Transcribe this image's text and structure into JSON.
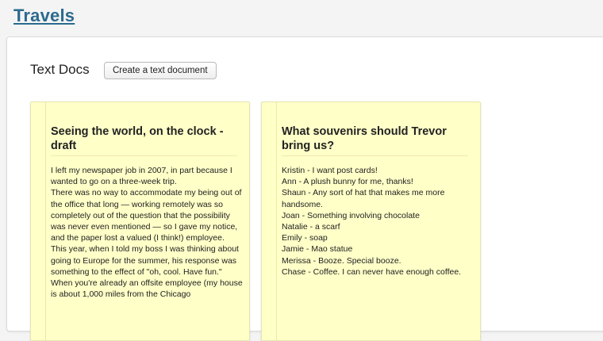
{
  "header": {
    "title": "Travels"
  },
  "section": {
    "title": "Text Docs",
    "create_label": "Create a text document"
  },
  "documents": [
    {
      "title": "Seeing the world, on the clock - draft",
      "lines": [
        "I left my newspaper job in 2007, in part because I wanted to go on a three-week trip.",
        "There was no way to accommodate my being out of the office that long — working remotely was so completely out of the question that the possibility was never even mentioned — so I gave my notice, and the paper lost a valued (I think!) employee.",
        "This year, when I told my boss I was thinking about going to Europe for the summer, his response was something to the effect of \"oh, cool. Have fun.\"",
        "When you're already an offsite employee (my house is about 1,000 miles from the Chicago"
      ]
    },
    {
      "title": "What souvenirs should Trevor bring us?",
      "lines": [
        "Kristin - I want post cards!",
        "Ann - A plush bunny for me, thanks!",
        "Shaun - Any sort of hat that makes me more handsome.",
        "Joan - Something involving chocolate",
        "Natalie - a scarf",
        "Emily - soap",
        "Jamie - Mao statue",
        "Merissa - Booze. Special booze.",
        "Chase - Coffee. I can never have enough coffee."
      ]
    }
  ]
}
